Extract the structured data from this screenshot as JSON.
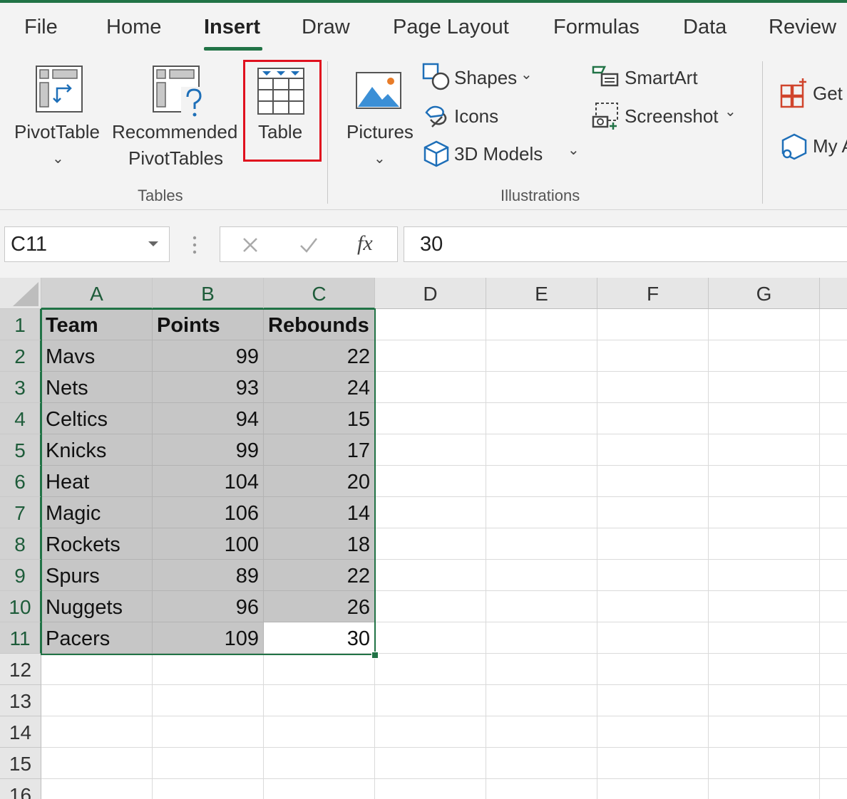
{
  "ribbon": {
    "tabs": [
      "File",
      "Home",
      "Insert",
      "Draw",
      "Page Layout",
      "Formulas",
      "Data",
      "Review"
    ],
    "active_tab": "Insert",
    "groups": {
      "tables": {
        "label": "Tables",
        "pivot_table": "PivotTable",
        "recommended_line1": "Recommended",
        "recommended_line2": "PivotTables",
        "table": "Table"
      },
      "illustrations": {
        "label": "Illustrations",
        "pictures": "Pictures",
        "shapes": "Shapes",
        "icons": "Icons",
        "models3d": "3D Models",
        "smartart": "SmartArt",
        "screenshot": "Screenshot"
      },
      "addins": {
        "get": "Get",
        "my": "My A"
      }
    },
    "highlighted_button": "Table",
    "highlight_color": "#e0101e",
    "accent_color": "#217346"
  },
  "formula_bar": {
    "name_box": "C11",
    "fx": "fx",
    "value": "30"
  },
  "sheet": {
    "columns": [
      "A",
      "B",
      "C",
      "D",
      "E",
      "F",
      "G"
    ],
    "rows": [
      "1",
      "2",
      "3",
      "4",
      "5",
      "6",
      "7",
      "8",
      "9",
      "10",
      "11",
      "12",
      "13",
      "14",
      "15",
      "16"
    ],
    "header": [
      "Team",
      "Points",
      "Rebounds"
    ],
    "data": [
      [
        "Mavs",
        "99",
        "22"
      ],
      [
        "Nets",
        "93",
        "24"
      ],
      [
        "Celtics",
        "94",
        "15"
      ],
      [
        "Knicks",
        "99",
        "17"
      ],
      [
        "Heat",
        "104",
        "20"
      ],
      [
        "Magic",
        "106",
        "14"
      ],
      [
        "Rockets",
        "100",
        "18"
      ],
      [
        "Spurs",
        "89",
        "22"
      ],
      [
        "Nuggets",
        "96",
        "26"
      ],
      [
        "Pacers",
        "109",
        "30"
      ]
    ],
    "active_cell": "C11",
    "selection": "A1:C11"
  }
}
